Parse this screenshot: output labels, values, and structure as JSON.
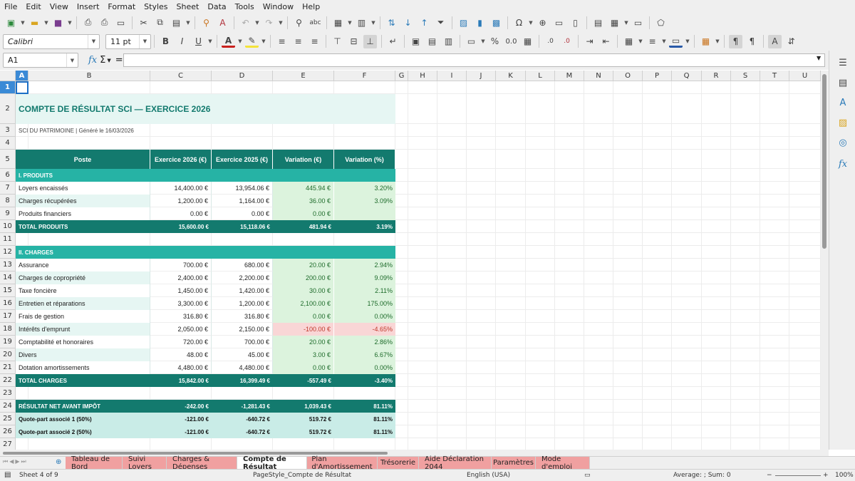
{
  "menu": [
    "File",
    "Edit",
    "View",
    "Insert",
    "Format",
    "Styles",
    "Sheet",
    "Data",
    "Tools",
    "Window",
    "Help"
  ],
  "toolbar": {
    "font_name": "Calibri",
    "font_size": "11 pt",
    "bold": "B",
    "italic": "I",
    "underline": "U",
    "percent": "%",
    "decimals": "0.0",
    "omega": "Ω"
  },
  "formula_bar": {
    "name_box": "A1",
    "sigma": "Σ",
    "equals": "=",
    "fx": "fx",
    "value": ""
  },
  "columns": [
    "A",
    "B",
    "C",
    "D",
    "E",
    "F",
    "G",
    "H",
    "I",
    "J",
    "K",
    "L",
    "M",
    "N",
    "O",
    "P",
    "Q",
    "R",
    "S",
    "T",
    "U"
  ],
  "rows": [
    "1",
    "2",
    "3",
    "4",
    "5",
    "6",
    "7",
    "8",
    "9",
    "10",
    "11",
    "12",
    "13",
    "14",
    "15",
    "16",
    "17",
    "18",
    "19",
    "20",
    "21",
    "22",
    "23",
    "24",
    "25",
    "26",
    "27",
    "28"
  ],
  "sheet": {
    "title": "COMPTE DE RÉSULTAT SCI — EXERCICE 2026",
    "subtitle": "SCI DU PATRIMOINE  |  Généré le 16/03/2026",
    "headers": [
      "Poste",
      "Exercice 2026 (€)",
      "Exercice 2025 (€)",
      "Variation (€)",
      "Variation (%)"
    ],
    "produits_label": "I. PRODUITS",
    "produits": [
      {
        "poste": "Loyers encaissés",
        "y2026": "14,400.00 €",
        "y2025": "13,954.06 €",
        "var": "445.94 €",
        "pct": "3.20%"
      },
      {
        "poste": "Charges récupérées",
        "y2026": "1,200.00 €",
        "y2025": "1,164.00 €",
        "var": "36.00 €",
        "pct": "3.09%"
      },
      {
        "poste": "Produits financiers",
        "y2026": "0.00 €",
        "y2025": "0.00 €",
        "var": "0.00 €",
        "pct": ""
      }
    ],
    "total_produits": {
      "poste": "TOTAL PRODUITS",
      "y2026": "15,600.00 €",
      "y2025": "15,118.06 €",
      "var": "481.94 €",
      "pct": "3.19%"
    },
    "charges_label": "II. CHARGES",
    "charges": [
      {
        "poste": "Assurance",
        "y2026": "700.00 €",
        "y2025": "680.00 €",
        "var": "20.00 €",
        "pct": "2.94%"
      },
      {
        "poste": "Charges de copropriété",
        "y2026": "2,400.00 €",
        "y2025": "2,200.00 €",
        "var": "200.00 €",
        "pct": "9.09%"
      },
      {
        "poste": "Taxe foncière",
        "y2026": "1,450.00 €",
        "y2025": "1,420.00 €",
        "var": "30.00 €",
        "pct": "2.11%"
      },
      {
        "poste": "Entretien et réparations",
        "y2026": "3,300.00 €",
        "y2025": "1,200.00 €",
        "var": "2,100.00 €",
        "pct": "175.00%"
      },
      {
        "poste": "Frais de gestion",
        "y2026": "316.80 €",
        "y2025": "316.80 €",
        "var": "0.00 €",
        "pct": "0.00%"
      },
      {
        "poste": "Intérêts d'emprunt",
        "y2026": "2,050.00 €",
        "y2025": "2,150.00 €",
        "var": "-100.00 €",
        "pct": "-4.65%"
      },
      {
        "poste": "Comptabilité et honoraires",
        "y2026": "720.00 €",
        "y2025": "700.00 €",
        "var": "20.00 €",
        "pct": "2.86%"
      },
      {
        "poste": "Divers",
        "y2026": "48.00 €",
        "y2025": "45.00 €",
        "var": "3.00 €",
        "pct": "6.67%"
      },
      {
        "poste": "Dotation amortissements",
        "y2026": "4,480.00 €",
        "y2025": "4,480.00 €",
        "var": "0.00 €",
        "pct": "0.00%"
      }
    ],
    "total_charges": {
      "poste": "TOTAL CHARGES",
      "y2026": "15,842.00 €",
      "y2025": "16,399.49 €",
      "var": "-557.49 €",
      "pct": "-3.40%"
    },
    "resultat": {
      "poste": "RÉSULTAT NET AVANT IMPÔT",
      "y2026": "-242.00 €",
      "y2025": "-1,281.43 €",
      "var": "1,039.43 €",
      "pct": "81.11%"
    },
    "associes": [
      {
        "poste": "Quote-part associé 1 (50%)",
        "y2026": "-121.00 €",
        "y2025": "-640.72 €",
        "var": "519.72 €",
        "pct": "81.11%"
      },
      {
        "poste": "Quote-part associé 2 (50%)",
        "y2026": "-121.00 €",
        "y2025": "-640.72 €",
        "var": "519.72 €",
        "pct": "81.11%"
      }
    ]
  },
  "tabs": [
    "Tableau de Bord",
    "Suivi Loyers",
    "Charges & Dépenses",
    "Compte de Résultat",
    "Plan d'Amortissement",
    "Trésorerie",
    "Aide Déclaration 2044",
    "Paramètres",
    "Mode d'emploi"
  ],
  "active_tab": "Compte de Résultat",
  "status": {
    "sheet": "Sheet 4 of 9",
    "page_style": "PageStyle_Compte de Résultat",
    "language": "English (USA)",
    "summary": "Average: ; Sum: 0",
    "zoom": "100%"
  },
  "colors": {
    "teal_dark": "#137a6e",
    "teal_mid": "#26b3a5",
    "teal_light": "#e6f6f3",
    "green_light": "#dcf3dd",
    "red_light": "#f9d6d6",
    "red_text": "#c0392b",
    "tab_pink": "#f0a0a0"
  }
}
